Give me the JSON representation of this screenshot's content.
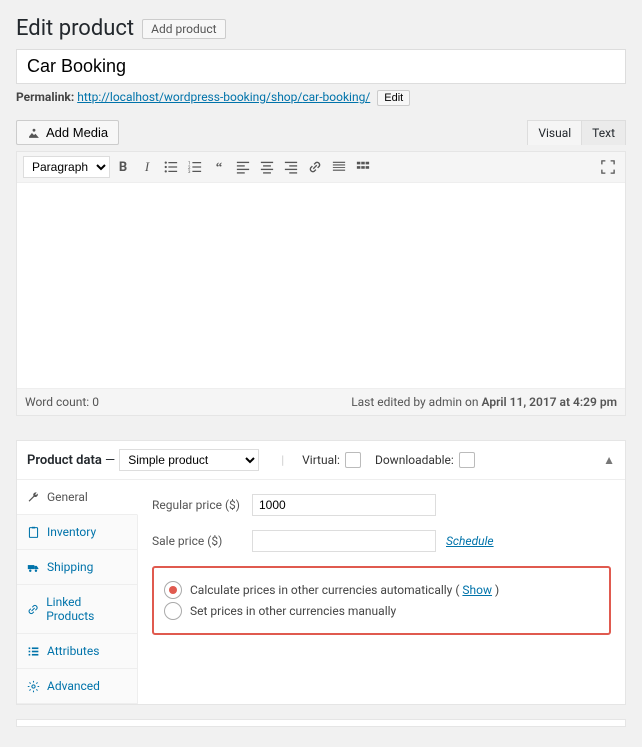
{
  "header": {
    "title": "Edit product",
    "add_new": "Add product"
  },
  "product_title": "Car Booking",
  "permalink": {
    "label": "Permalink:",
    "base": "http://localhost/wordpress-booking/shop/",
    "slug": "car-booking/",
    "edit": "Edit"
  },
  "media": {
    "add_media": "Add Media"
  },
  "editor_tabs": {
    "visual": "Visual",
    "text": "Text"
  },
  "toolbar": {
    "format": "Paragraph"
  },
  "status": {
    "wc_label": "Word count:",
    "wc_value": "0",
    "last_edit": "Last edited by admin on ",
    "last_edit_date": "April 11, 2017 at 4:29 pm"
  },
  "pd": {
    "title": "Product data",
    "dash": "—",
    "type": "Simple product",
    "virtual": "Virtual:",
    "downloadable": "Downloadable:",
    "collapse": "▲",
    "tabs": {
      "general": "General",
      "inventory": "Inventory",
      "shipping": "Shipping",
      "linked": "Linked Products",
      "attributes": "Attributes",
      "advanced": "Advanced"
    },
    "fields": {
      "reg_label": "Regular price ($)",
      "reg_value": "1000",
      "sale_label": "Sale price ($)",
      "sale_value": "",
      "schedule": "Schedule"
    },
    "radio": {
      "auto_pre": "Calculate prices in other currencies automatically  ( ",
      "auto_link": "Show",
      "auto_post": " )",
      "manual": "Set prices in other currencies manually"
    }
  }
}
